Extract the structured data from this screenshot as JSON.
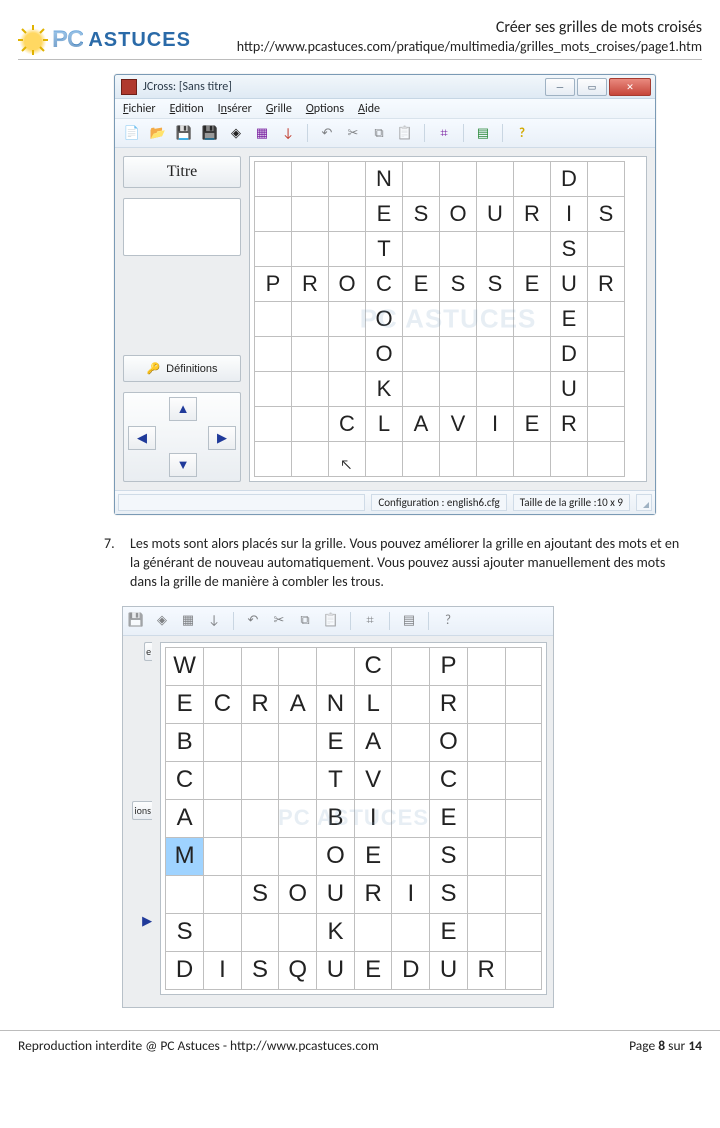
{
  "header": {
    "logo_pc": "PC",
    "logo_astuces": "ASTUCES",
    "title": "Créer ses grilles de mots croisés",
    "url": "http://www.pcastuces.com/pratique/multimedia/grilles_mots_croises/page1.htm"
  },
  "window1": {
    "title": "JCross: [Sans titre]",
    "menu": [
      "Fichier",
      "Edition",
      "Insérer",
      "Grille",
      "Options",
      "Aide"
    ],
    "toolbar_icons": [
      "new-icon",
      "open-icon",
      "save-icon",
      "saveas-icon",
      "export-icon",
      "props-icon",
      "insert-icon",
      "undo-icon",
      "cut-icon",
      "copy-icon",
      "paste-icon",
      "compile-icon",
      "preview-icon",
      "help-icon"
    ],
    "sidebar": {
      "titre": "Titre",
      "definitions": "Définitions"
    },
    "status": {
      "config": "Configuration : english6.cfg",
      "size": "Taille de la grille :10 x 9"
    },
    "grid": {
      "rows": 9,
      "cols": 10,
      "cells": {
        "r0c3": "N",
        "r0c8": "D",
        "r1c3": "E",
        "r1c4": "S",
        "r1c5": "O",
        "r1c6": "U",
        "r1c7": "R",
        "r1c8": "I",
        "r1c9": "S",
        "r2c3": "T",
        "r2c8": "S",
        "r3c0": "P",
        "r3c1": "R",
        "r3c2": "O",
        "r3c3": "C",
        "r3c4": "E",
        "r3c5": "S",
        "r3c6": "S",
        "r3c7": "E",
        "r3c8": "U",
        "r3c9": "R",
        "r4c3": "O",
        "r4c8": "E",
        "r5c3": "O",
        "r5c8": "D",
        "r6c3": "K",
        "r6c8": "U",
        "r7c2": "C",
        "r7c3": "L",
        "r7c4": "A",
        "r7c5": "V",
        "r7c6": "I",
        "r7c7": "E",
        "r7c8": "R"
      }
    }
  },
  "paragraph": {
    "number": "7.",
    "text": "Les mots sont alors placés sur la grille. Vous pouvez améliorer la grille en ajoutant des mots et en la générant de nouveau automatiquement. Vous pouvez aussi ajouter manuellement des mots dans la grille de manière à combler les trous."
  },
  "window2": {
    "sidebar": {
      "e": "e",
      "ions": "ions"
    },
    "grid": {
      "rows": 9,
      "cols": 10,
      "cells": {
        "r0c0": "W",
        "r0c5": "C",
        "r0c7": "P",
        "r1c0": "E",
        "r1c1": "C",
        "r1c2": "R",
        "r1c3": "A",
        "r1c4": "N",
        "r1c5": "L",
        "r1c7": "R",
        "r2c0": "B",
        "r2c4": "E",
        "r2c5": "A",
        "r2c7": "O",
        "r3c0": "C",
        "r3c4": "T",
        "r3c5": "V",
        "r3c7": "C",
        "r4c0": "A",
        "r4c4": "B",
        "r4c5": "I",
        "r4c7": "E",
        "r5c0": "M",
        "r5c4": "O",
        "r5c5": "E",
        "r5c7": "S",
        "r6c2": "S",
        "r6c3": "O",
        "r6c4": "U",
        "r6c5": "R",
        "r6c6": "I",
        "r6c7": "S",
        "r7c0": "S",
        "r7c4": "K",
        "r7c7": "E",
        "r8c0": "D",
        "r8c1": "I",
        "r8c2": "S",
        "r8c3": "Q",
        "r8c4": "U",
        "r8c5": "E",
        "r8c6": "D",
        "r8c7": "U",
        "r8c8": "R"
      },
      "selected": "r5c0"
    }
  },
  "footer": {
    "left": "Reproduction interdite @ PC Astuces - http://www.pcastuces.com",
    "right_prefix": "Page ",
    "right_num": "8",
    "right_mid": " sur ",
    "right_total": "14"
  },
  "labels": {
    "watermark": "PC ASTUCES"
  }
}
